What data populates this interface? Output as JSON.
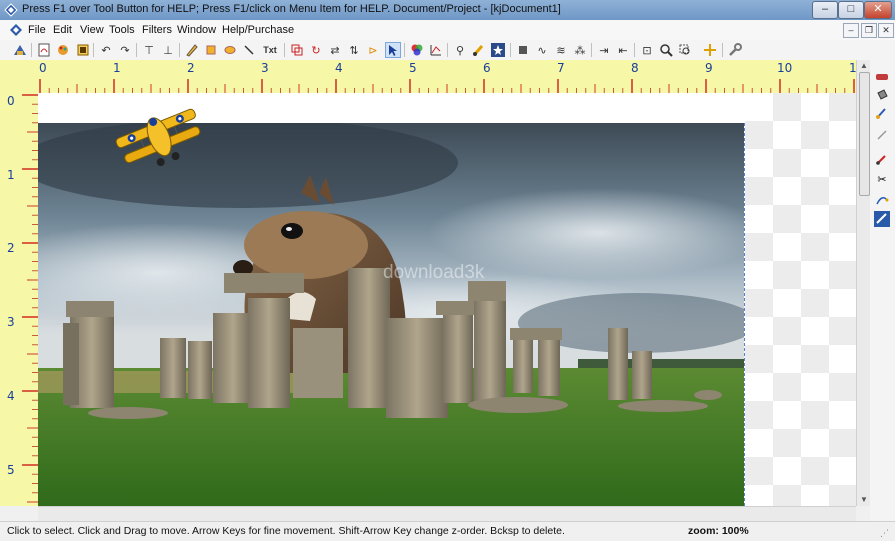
{
  "window": {
    "title": "Press F1 over Tool Button for HELP; Press F1/click on Menu Item for HELP.   Document/Project - [kjDocument1]",
    "minimize": "–",
    "maximize": "□",
    "close": "✕"
  },
  "menu": {
    "items": [
      "File",
      "Edit",
      "View",
      "Tools",
      "Filters",
      "Window",
      "Help/Purchase"
    ]
  },
  "toolbar": {
    "text_tool": "Txt"
  },
  "ruler": {
    "top_labels": [
      "0",
      "1",
      "2",
      "3",
      "4",
      "5",
      "6",
      "7",
      "8",
      "9",
      "10",
      "1"
    ],
    "left_labels": [
      "0",
      "1",
      "2",
      "3",
      "4",
      "5"
    ]
  },
  "canvas": {
    "watermark": "download3k"
  },
  "status": {
    "message": "Click to select.  Click and Drag to move.  Arrow Keys for fine movement.  Shift-Arrow Key change z-order.  Bcksp to delete.",
    "zoom": "zoom: 100%"
  },
  "colors": {
    "ruler": "#f7f7a8",
    "ruler_text": "#1a3f9a",
    "selection_outline": "#5a7fd0"
  }
}
